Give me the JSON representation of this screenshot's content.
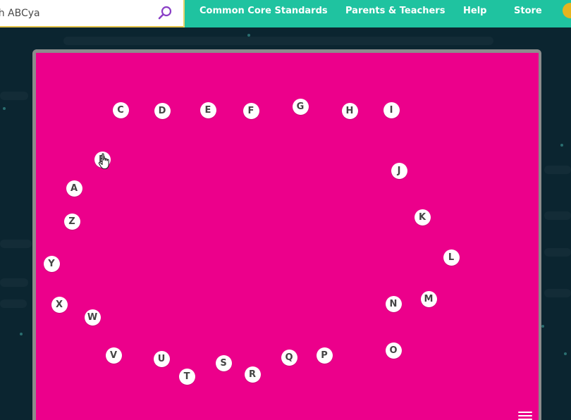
{
  "header": {
    "search_placeholder": "ch ABCya",
    "nav": [
      "Common Core Standards",
      "Parents & Teachers",
      "Help",
      "Store"
    ]
  },
  "game": {
    "letters": [
      "C",
      "D",
      "E",
      "F",
      "G",
      "H",
      "I",
      "J",
      "K",
      "L",
      "M",
      "N",
      "O",
      "P",
      "Q",
      "R",
      "S",
      "T",
      "U",
      "V",
      "W",
      "X",
      "Y",
      "Z",
      "A",
      "B"
    ]
  },
  "colors": {
    "board": "#ec008b",
    "nav": "#1fc3a0",
    "background": "#0b2530"
  },
  "icons": {
    "search": "search-icon",
    "cursor": "hand-pointer-icon",
    "menu": "hamburger-menu-icon"
  }
}
